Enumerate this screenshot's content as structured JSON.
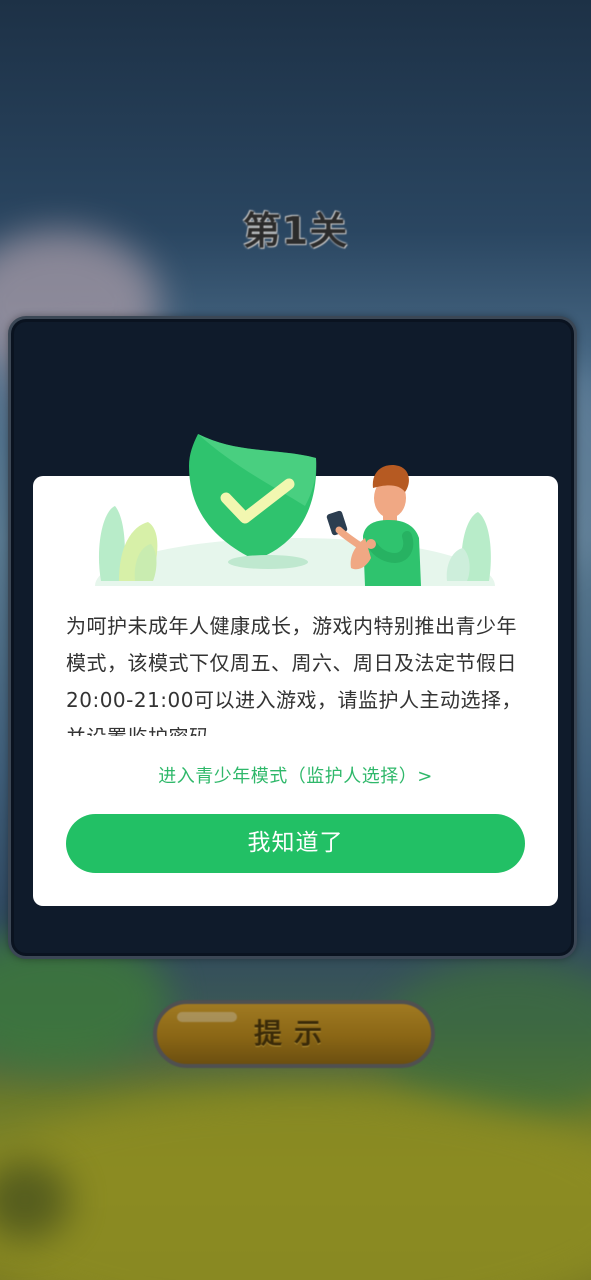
{
  "level": {
    "title": "第1关"
  },
  "hint_button": {
    "label": "提示"
  },
  "notice_dialog": {
    "text": "为呵护未成年人健康成长，游戏内特别推出青少年模式，该模式下仅周五、周六、周日及法定节假日20:00-21:00可以进入游戏，请监护人主动选择，并设置监护密码。",
    "youth_mode_link": "进入青少年模式（监护人选择）>",
    "confirm_button": "我知道了",
    "illustration_icon": "green-shield-check",
    "colors": {
      "accent_green": "#22c065",
      "link_green": "#2fb86a"
    }
  }
}
